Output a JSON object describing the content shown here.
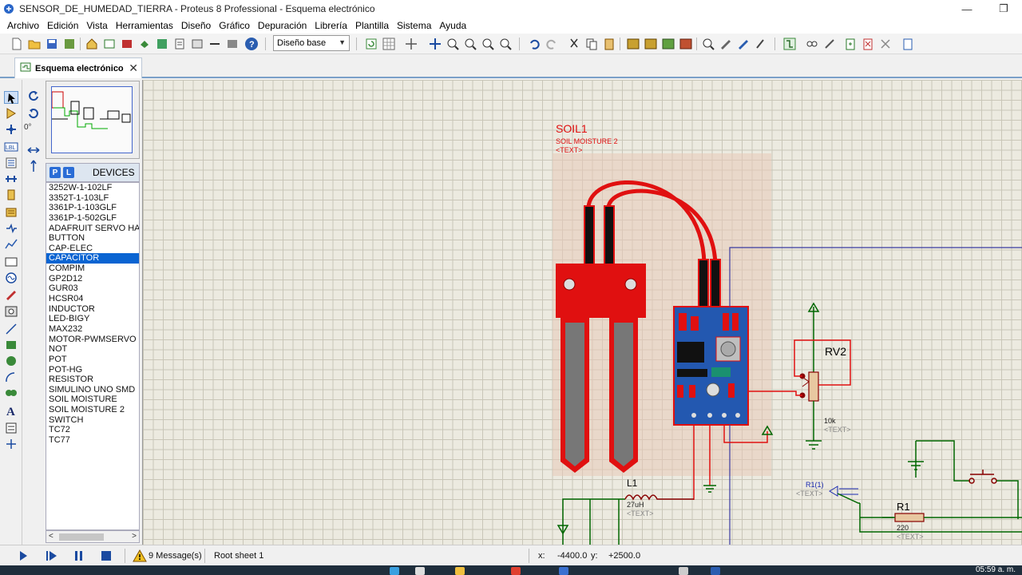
{
  "window": {
    "title": "SENSOR_DE_HUMEDAD_TIERRA - Proteus 8 Professional - Esquema electrónico",
    "minimize": "—",
    "maximize": "❐"
  },
  "menu": [
    "Archivo",
    "Edición",
    "Vista",
    "Herramientas",
    "Diseño",
    "Gráfico",
    "Depuración",
    "Librería",
    "Plantilla",
    "Sistema",
    "Ayuda"
  ],
  "toolbar": {
    "design_select": "Diseño base"
  },
  "tab": {
    "label": "Esquema electrónico",
    "close": "✕"
  },
  "rotation": {
    "value": "0°"
  },
  "devices": {
    "p_button": "P",
    "l_button": "L",
    "title": "DEVICES",
    "items": [
      "3252W-1-102LF",
      "3352T-1-103LF",
      "3361P-1-103GLF",
      "3361P-1-502GLF",
      "ADAFRUIT SERVO HA",
      "BUTTON",
      "CAP-ELEC",
      "CAPACITOR",
      "COMPIM",
      "GP2D12",
      "GUR03",
      "HCSR04",
      "INDUCTOR",
      "LED-BIGY",
      "MAX232",
      "MOTOR-PWMSERVO",
      "NOT",
      "POT",
      "POT-HG",
      "RESISTOR",
      "SIMULINO UNO SMD",
      "SOIL MOISTURE",
      "SOIL MOISTURE 2",
      "SWITCH",
      "TC72",
      "TC77"
    ],
    "selected": "CAPACITOR"
  },
  "schematic": {
    "soil_ref": "SOIL1",
    "soil_value": "SOIL MOISTURE 2",
    "soil_text": "<TEXT>",
    "rv2_ref": "RV2",
    "rv2_value": "10k",
    "rv2_text": "<TEXT>",
    "l1_ref": "L1",
    "l1_value": "27uH",
    "l1_text": "<TEXT>",
    "r1_ref": "R1",
    "r1_value": "220",
    "r1_text": "<TEXT>",
    "r1_1_label": "R1(1)",
    "r1_1_text": "<TEXT>"
  },
  "status": {
    "messages": "9 Message(s)",
    "sheet": "Root sheet 1",
    "x_label": "x:",
    "x_value": "-4400.0",
    "y_label": "y:",
    "y_value": "+2500.0"
  },
  "taskbar": {
    "clock": "05:59 a. m."
  }
}
